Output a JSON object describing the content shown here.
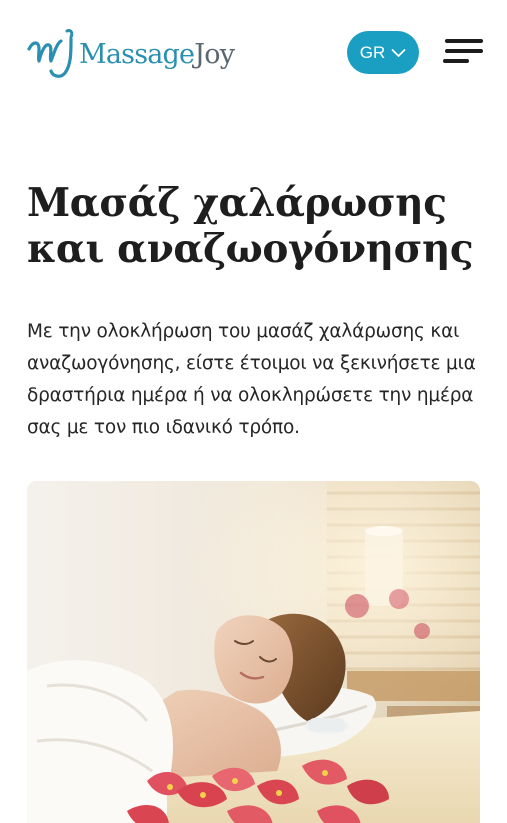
{
  "header": {
    "logo": {
      "brand_part1": "Massage",
      "brand_part2": "Joy",
      "icon": "mj-brush-logo-icon",
      "color": "#2a8fb0"
    },
    "language": {
      "label": "GR",
      "icon": "chevron-down-icon",
      "background": "#1a9fc2"
    },
    "menu": {
      "icon": "hamburger-menu-icon"
    }
  },
  "main": {
    "title": "Μασάζ χαλάρωσης και αναζωογόνησης",
    "intro": "Με την ολοκλήρωση του μασάζ χαλάρωσης και αναζωογόνησης, είστε έτοιμοι να ξεκινήσετε μια δραστήρια ημέρα ή να ολοκληρώσετε την ημέρα σας με τον πιο ιδανικό τρόπο."
  }
}
